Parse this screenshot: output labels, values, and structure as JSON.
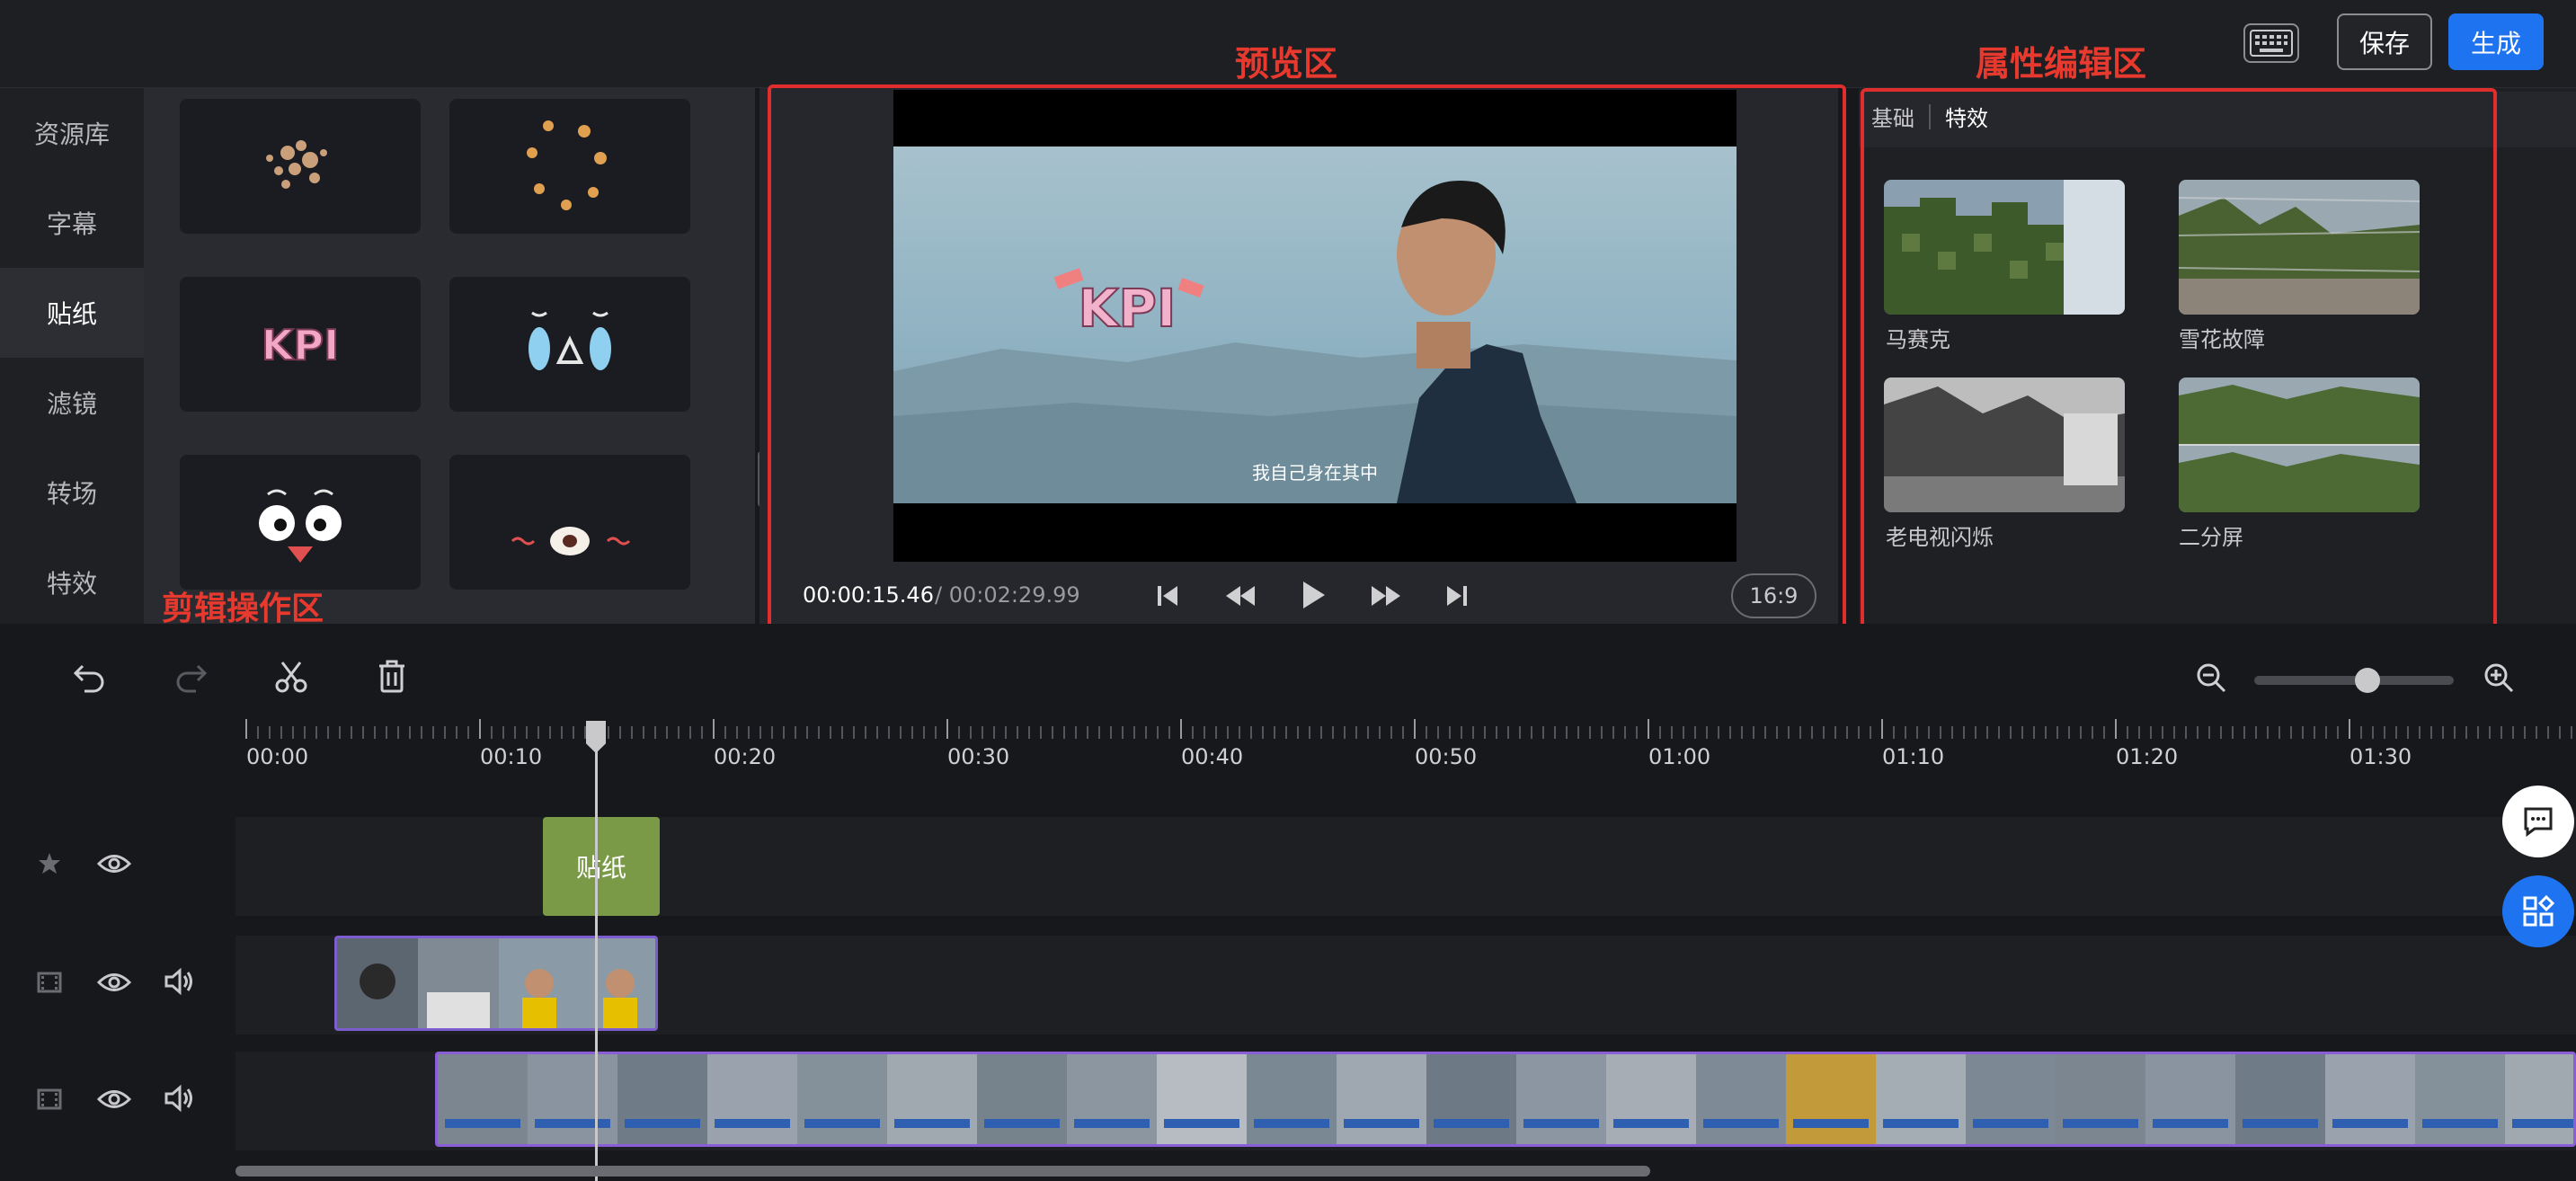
{
  "topbar": {
    "save_label": "保存",
    "generate_label": "生成"
  },
  "annotations": {
    "preview_label": "预览区",
    "props_label": "属性编辑区",
    "edit_label": "剪辑操作区"
  },
  "leftnav": {
    "items": [
      {
        "label": "资源库",
        "active": false
      },
      {
        "label": "字幕",
        "active": false
      },
      {
        "label": "贴纸",
        "active": true
      },
      {
        "label": "滤镜",
        "active": false
      },
      {
        "label": "转场",
        "active": false
      },
      {
        "label": "特效",
        "active": false
      }
    ]
  },
  "preview": {
    "current_time": "00:00:15.46",
    "total_time": "/ 00:02:29.99",
    "aspect_ratio": "16:9",
    "subtitle": "我自己身在其中",
    "sticker_text": "KPI"
  },
  "props": {
    "tabs": [
      "基础",
      "特效"
    ],
    "active_tab": "特效",
    "effects": [
      {
        "label": "马赛克"
      },
      {
        "label": "雪花故障"
      },
      {
        "label": "老电视闪烁"
      },
      {
        "label": "二分屏"
      }
    ]
  },
  "timeline": {
    "ticks": [
      "00:00",
      "00:10",
      "00:20",
      "00:30",
      "00:40",
      "00:50",
      "01:00",
      "01:10",
      "01:20",
      "01:30"
    ],
    "sticker_clip_label": "贴纸",
    "zoom_level": 0.55
  }
}
